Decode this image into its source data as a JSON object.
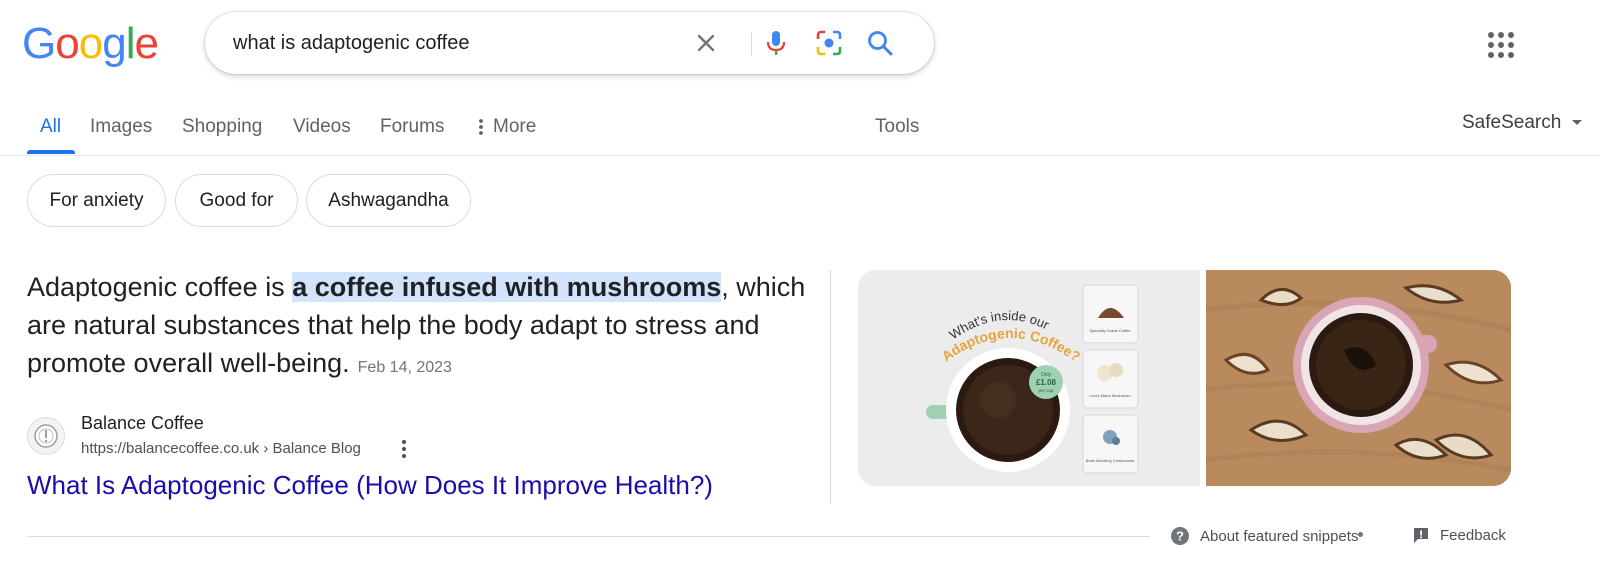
{
  "logo": {
    "text": "Google",
    "letters": [
      "G",
      "o",
      "o",
      "g",
      "l",
      "e"
    ],
    "colors": [
      "#4285F4",
      "#EA4335",
      "#FBBC05",
      "#4285F4",
      "#34A853",
      "#EA4335"
    ]
  },
  "search": {
    "value": "what is adaptogenic coffee"
  },
  "tabs": [
    {
      "label": "All",
      "active": true
    },
    {
      "label": "Images"
    },
    {
      "label": "Shopping"
    },
    {
      "label": "Videos"
    },
    {
      "label": "Forums"
    },
    {
      "label": "More"
    },
    {
      "label": "Tools"
    }
  ],
  "safesearch": {
    "label": "SafeSearch"
  },
  "chips": [
    "For anxiety",
    "Good for",
    "Ashwagandha"
  ],
  "snippet": {
    "text_before": "Adaptogenic coffee is ",
    "highlight": "a coffee infused with mushrooms",
    "text_after": ", which are natural substances that help the body adapt to stress and promote overall well-being.",
    "date": "Feb 14, 2023"
  },
  "source": {
    "name": "Balance Coffee",
    "url": "https://balancecoffee.co.uk › Balance Blog",
    "link_title": "What Is Adaptogenic Coffee (How Does It Improve Health?)"
  },
  "image1": {
    "heading_line1": "What's inside our",
    "heading_line2": "Adaptogenic Coffee?",
    "price_line1": "Only",
    "price_line2": "£1.08",
    "price_line3": "per cup",
    "items": [
      "Specialty Grade Coffee",
      "Lion's Mane Mushroom",
      "Brain Boosting Compounds"
    ]
  },
  "footer": {
    "about": "About featured snippets",
    "feedback": "Feedback"
  },
  "colors": {
    "accent": "#1a73e8",
    "link": "#1a0dab",
    "highlight": "#d2e3fc"
  }
}
